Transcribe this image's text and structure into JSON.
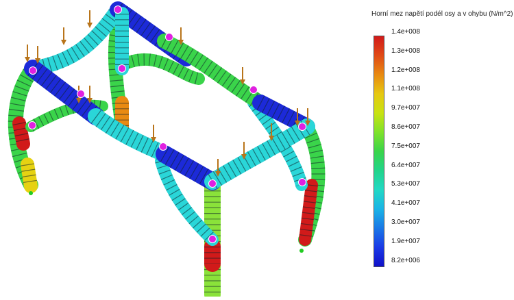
{
  "legend": {
    "title": "Horní mez napětí podél osy a v ohybu (N/m^2)",
    "ticks": [
      "1.4e+008",
      "1.3e+008",
      "1.2e+008",
      "1.1e+008",
      "9.7e+007",
      "8.6e+007",
      "7.5e+007",
      "6.4e+007",
      "5.3e+007",
      "4.1e+007",
      "3.0e+007",
      "1.9e+007",
      "8.2e+006"
    ],
    "colors": [
      "#d11a1a",
      "#e04a16",
      "#e88a12",
      "#e6c812",
      "#c8e212",
      "#7fe22a",
      "#3ad44a",
      "#22d48a",
      "#22d8c4",
      "#1ab4e6",
      "#1a78e6",
      "#1a3ae6",
      "#1010c8"
    ]
  },
  "viewport": {
    "model": "beam-frame-stress-plot",
    "load_arrow_color": "#b8741a",
    "joint_marker_color": "#e020e0",
    "fixture_color": "#22cc22"
  }
}
